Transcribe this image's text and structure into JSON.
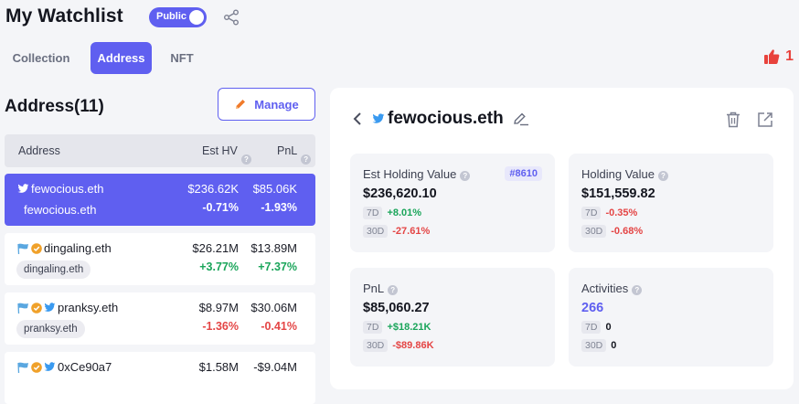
{
  "header": {
    "title": "My Watchlist",
    "visibility_label": "Public"
  },
  "tabs": [
    {
      "label": "Collection"
    },
    {
      "label": "Address"
    },
    {
      "label": "NFT"
    }
  ],
  "likes": {
    "count": "1"
  },
  "address_panel": {
    "title": "Address(11)",
    "manage_label": "Manage",
    "columns": {
      "address": "Address",
      "est_hv": "Est HV",
      "pnl": "PnL"
    },
    "rows": [
      {
        "name": "fewocious.eth",
        "tag": "fewocious.eth",
        "est_hv": "$236.62K",
        "hv_change": "-0.71%",
        "pnl": "$85.06K",
        "pnl_change": "-1.93%"
      },
      {
        "name": "dingaling.eth",
        "tag": "dingaling.eth",
        "est_hv": "$26.21M",
        "hv_change": "+3.77%",
        "pnl": "$13.89M",
        "pnl_change": "+7.37%"
      },
      {
        "name": "pranksy.eth",
        "tag": "pranksy.eth",
        "est_hv": "$8.97M",
        "hv_change": "-1.36%",
        "pnl": "$30.06M",
        "pnl_change": "-0.41%"
      },
      {
        "name": "0xCe90a7",
        "tag": "",
        "est_hv": "$1.58M",
        "hv_change": "",
        "pnl": "-$9.04M",
        "pnl_change": ""
      }
    ]
  },
  "detail": {
    "name": "fewocious.eth",
    "cards": {
      "est_holding": {
        "label": "Est Holding Value",
        "rank": "#8610",
        "value": "$236,620.10",
        "d7_label": "7D",
        "d7": "+8.01%",
        "d30_label": "30D",
        "d30": "-27.61%"
      },
      "holding": {
        "label": "Holding Value",
        "value": "$151,559.82",
        "d7_label": "7D",
        "d7": "-0.35%",
        "d30_label": "30D",
        "d30": "-0.68%"
      },
      "pnl": {
        "label": "PnL",
        "value": "$85,060.27",
        "d7_label": "7D",
        "d7": "+$18.21K",
        "d30_label": "30D",
        "d30": "-$89.86K"
      },
      "activities": {
        "label": "Activities",
        "value": "266",
        "d7_label": "7D",
        "d7": "0",
        "d30_label": "30D",
        "d30": "0"
      }
    }
  },
  "colors": {
    "accent": "#5f5ff0",
    "positive": "#1aa55a",
    "negative": "#e44545",
    "like": "#e8423c"
  },
  "icons": [
    "share-icon",
    "thumbs-up-icon",
    "pencil-icon",
    "question-icon",
    "twitter-bird-icon",
    "verified-badge-icon",
    "banner-flag-icon",
    "chevron-left-icon",
    "edit-icon",
    "trash-icon",
    "external-link-icon"
  ]
}
